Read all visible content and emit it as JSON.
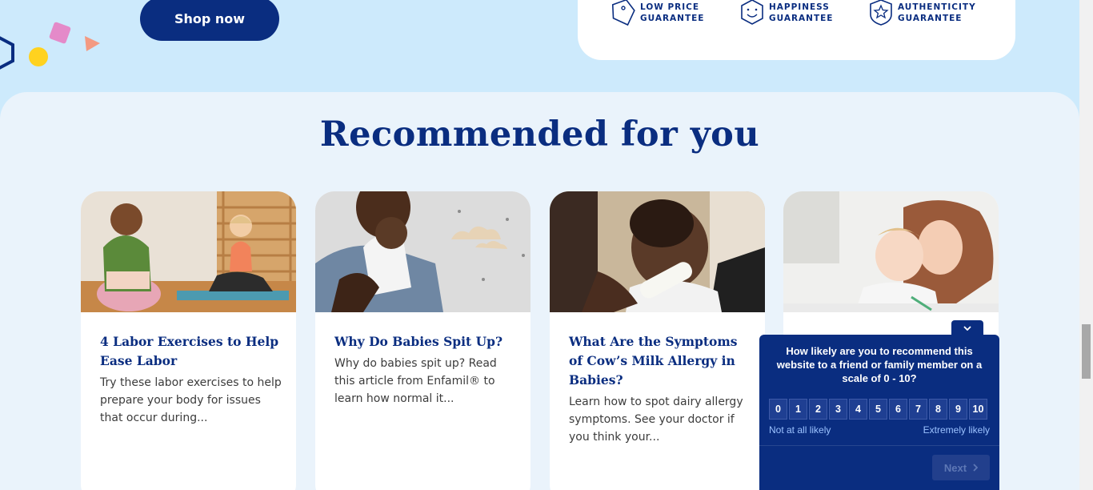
{
  "hero": {
    "shop_button": "Shop now",
    "guarantees": [
      {
        "line1": "LOW PRICE",
        "line2": "GUARANTEE",
        "icon": "price-tag-icon"
      },
      {
        "line1": "HAPPINESS",
        "line2": "GUARANTEE",
        "icon": "smiley-icon"
      },
      {
        "line1": "AUTHENTICITY",
        "line2": "GUARANTEE",
        "icon": "star-shield-icon"
      }
    ]
  },
  "recommended": {
    "title": "Recommended for you",
    "cards": [
      {
        "title": "4 Labor Exercises to Help Ease Labor",
        "description": "Try these labor exercises to help prepare your body for issues that occur during..."
      },
      {
        "title": "Why Do Babies Spit Up?",
        "description": "Why do babies spit up? Read this article from Enfamil® to learn how normal it..."
      },
      {
        "title": "What Are the Symptoms of Cow’s Milk Allergy in Babies?",
        "description": "Learn how to spot dairy allergy symptoms. See your doctor if you think your..."
      },
      {
        "title": "",
        "description": ""
      }
    ]
  },
  "survey": {
    "question": "How likely are you to recommend this website to a friend or family member on a scale of 0 - 10?",
    "scale": [
      "0",
      "1",
      "2",
      "3",
      "4",
      "5",
      "6",
      "7",
      "8",
      "9",
      "10"
    ],
    "low_label": "Not at all likely",
    "high_label": "Extremely likely",
    "next_label": "Next",
    "collapse_icon": "chevron-down-icon"
  },
  "colors": {
    "brand_navy": "#0a2d80",
    "hero_bg": "#cdeafc",
    "section_bg": "#eaf3fb"
  }
}
